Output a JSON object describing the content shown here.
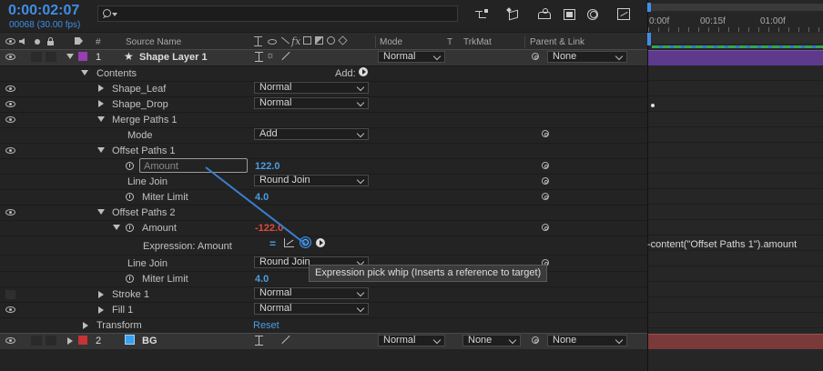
{
  "header": {
    "timecode": "0:00:02:07",
    "frame_info": "00068 (30.00 fps)",
    "search_placeholder": "",
    "tool_icons": [
      "composition-flowchart-icon",
      "draft-3d-icon",
      "shy-layers-icon",
      "frame-blending-icon",
      "motion-blur-icon",
      "graph-editor-icon"
    ]
  },
  "columns": {
    "num": "#",
    "source_name": "Source Name",
    "mode": "Mode",
    "t": "T",
    "trkmat": "TrkMat",
    "parent_link": "Parent & Link"
  },
  "timeline": {
    "rulers": [
      "0:00f",
      "00:15f",
      "01:00f"
    ],
    "expression_text": "-content(\"Offset Paths 1\").amount",
    "work_area_color": "#5d3a8c",
    "bg_bar_color": "#7a3a3a"
  },
  "layers": {
    "shape_layer": {
      "num": "1",
      "name": "Shape Layer 1",
      "mode": "Normal",
      "parent": "None",
      "label_color": "#9a3cb4"
    },
    "bg_layer": {
      "num": "2",
      "name": "BG",
      "mode": "Normal",
      "trkmat": "None",
      "parent": "None",
      "label_color": "#c83232",
      "source_color": "#3aa0f0"
    }
  },
  "tree": {
    "contents": "Contents",
    "add_label": "Add:",
    "shape_leaf": {
      "name": "Shape_Leaf",
      "mode": "Normal"
    },
    "shape_drop": {
      "name": "Shape_Drop",
      "mode": "Normal"
    },
    "merge_paths": {
      "name": "Merge Paths 1",
      "mode_label": "Mode",
      "mode_value": "Add"
    },
    "offset_paths_1": {
      "name": "Offset Paths 1",
      "amount_label": "Amount",
      "amount_value": "122.0",
      "line_join_label": "Line Join",
      "line_join_value": "Round Join",
      "miter_label": "Miter Limit",
      "miter_value": "4.0"
    },
    "offset_paths_2": {
      "name": "Offset Paths 2",
      "amount_label": "Amount",
      "amount_value": "-122.0",
      "expression_label": "Expression: Amount",
      "line_join_label": "Line Join",
      "line_join_value": "Round Join",
      "miter_label": "Miter Limit",
      "miter_value": "4.0"
    },
    "stroke": {
      "name": "Stroke 1",
      "mode": "Normal"
    },
    "fill": {
      "name": "Fill 1",
      "mode": "Normal"
    },
    "transform": {
      "name": "Transform",
      "reset": "Reset"
    }
  },
  "tooltip": {
    "text": "Expression pick whip (Inserts a reference to target)"
  }
}
